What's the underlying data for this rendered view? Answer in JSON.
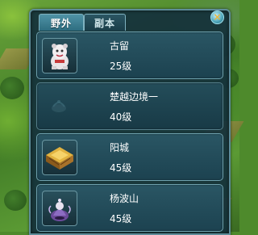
{
  "tabs": [
    {
      "label": "野外",
      "active": true
    },
    {
      "label": "副本",
      "active": false
    }
  ],
  "close_icon": "close-icon",
  "entries": [
    {
      "name": "古留",
      "level": "25级",
      "icon": "white-tiger-beast-icon",
      "locked": false
    },
    {
      "name": "楚越边境一",
      "level": "40级",
      "icon": "faded-crest-icon",
      "locked": true
    },
    {
      "name": "阳城",
      "level": "45级",
      "icon": "golden-pavilion-icon",
      "locked": false
    },
    {
      "name": "杨波山",
      "level": "45级",
      "icon": "purple-spirit-icon",
      "locked": false
    }
  ],
  "colors": {
    "panel_bg": "#15323c",
    "panel_border": "#5d8c98",
    "active_tab": "#3f8397",
    "text": "#ffffff"
  }
}
